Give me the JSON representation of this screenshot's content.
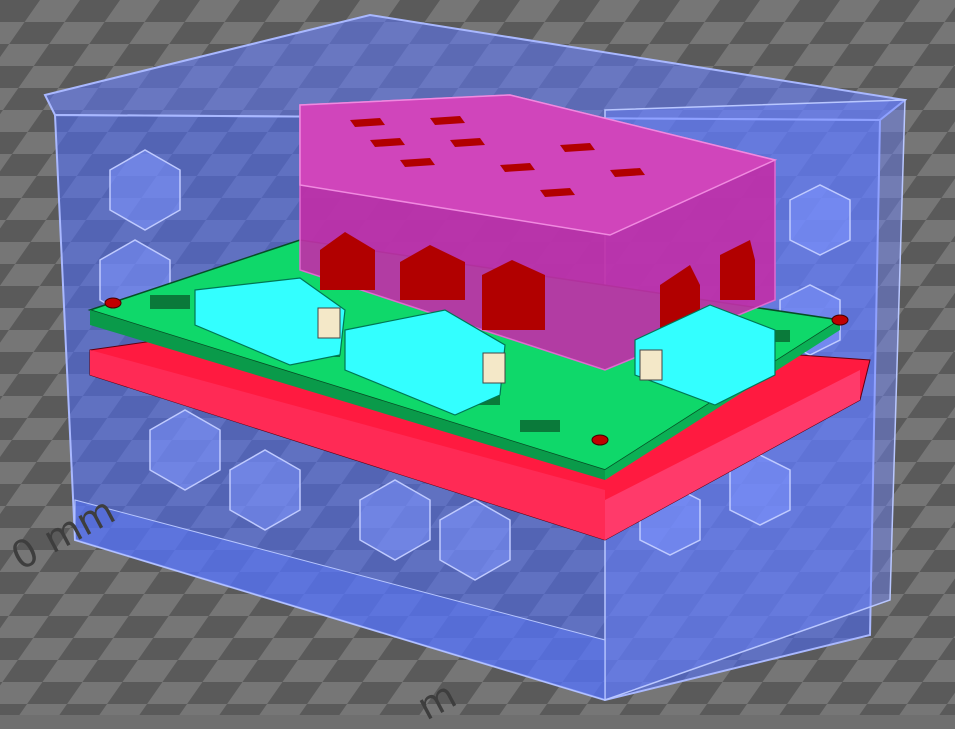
{
  "scene": {
    "description_free": true,
    "colors": {
      "bed_light": "#767676",
      "bed_dark": "#545454",
      "enclosure": "#4f6dff",
      "enclosure_edge": "#9fb2ff",
      "top_box": "#c02fa8",
      "top_box_edge": "#e06ad0",
      "window_red": "#b10000",
      "pcb_green": "#0fd86a",
      "pcb_dark": "#0a7a3a",
      "connector": "#33ffff",
      "base_red": "#ff1a40"
    },
    "icons": [
      "pcb-board",
      "usb-connector",
      "enclosure-box"
    ]
  },
  "axis_labels": {
    "left": "0 mm",
    "bottom": "m"
  }
}
